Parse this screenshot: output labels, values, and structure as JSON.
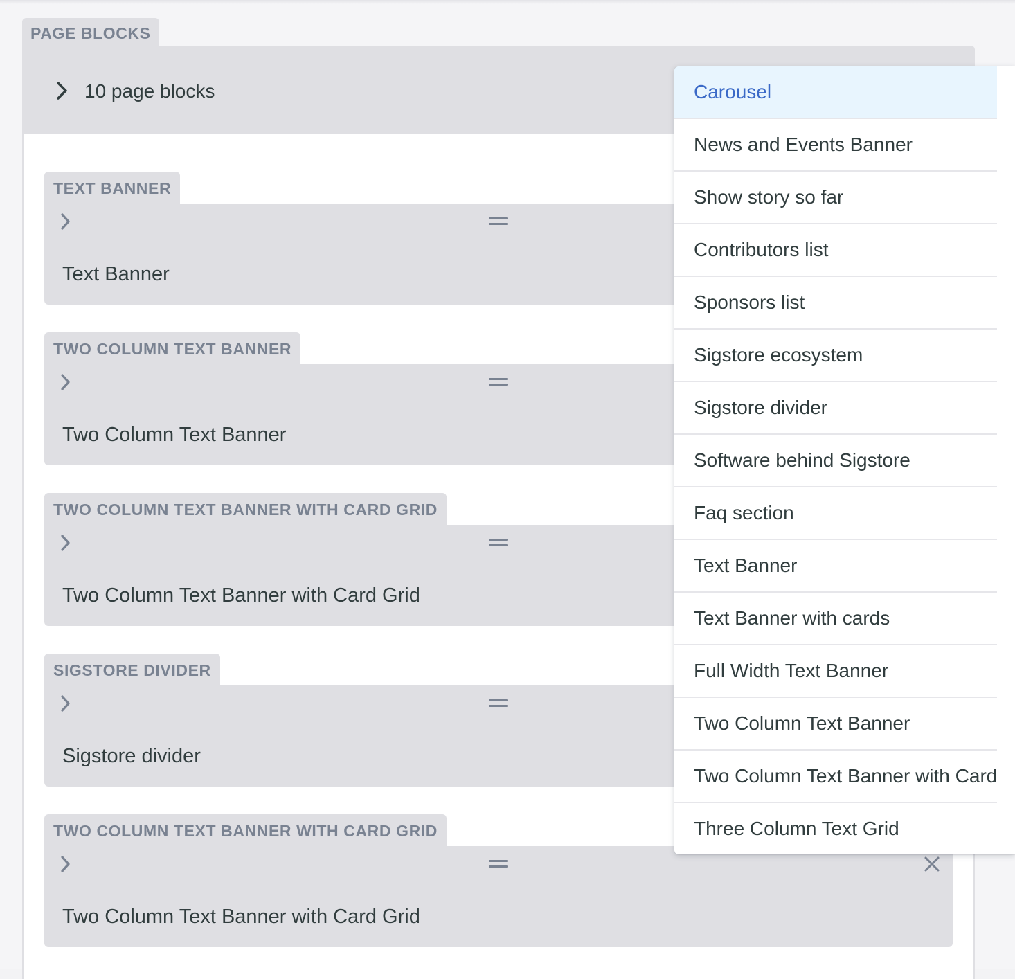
{
  "field_label": "PAGE BLOCKS",
  "list_header": {
    "count_label": "10 page blocks"
  },
  "blocks": [
    {
      "tag": "TEXT BANNER",
      "title": "Text Banner"
    },
    {
      "tag": "TWO COLUMN TEXT BANNER",
      "title": "Two Column Text Banner"
    },
    {
      "tag": "TWO COLUMN TEXT BANNER WITH CARD GRID",
      "title": "Two Column Text Banner with Card Grid"
    },
    {
      "tag": "SIGSTORE DIVIDER",
      "title": "Sigstore divider"
    },
    {
      "tag": "TWO COLUMN TEXT BANNER WITH CARD GRID",
      "title": "Two Column Text Banner with Card Grid"
    }
  ],
  "dropdown": {
    "active_index": 0,
    "items": [
      "Carousel",
      "News and Events Banner",
      "Show story so far",
      "Contributors list",
      "Sponsors list",
      "Sigstore ecosystem",
      "Sigstore divider",
      "Software behind Sigstore",
      "Faq section",
      "Text Banner",
      "Text Banner with cards",
      "Full Width Text Banner",
      "Two Column Text Banner",
      "Two Column Text Banner with Card Grid",
      "Three Column Text Grid"
    ]
  },
  "icons": {
    "expand": "chevron-right-icon",
    "drag": "drag-handle-icon",
    "remove": "close-icon"
  },
  "colors": {
    "panel": "#dfdfe3",
    "label_text": "#798291",
    "body_text": "#313d3e",
    "active_item_bg": "#e8f5fe",
    "active_item_text": "#3a69c7"
  }
}
